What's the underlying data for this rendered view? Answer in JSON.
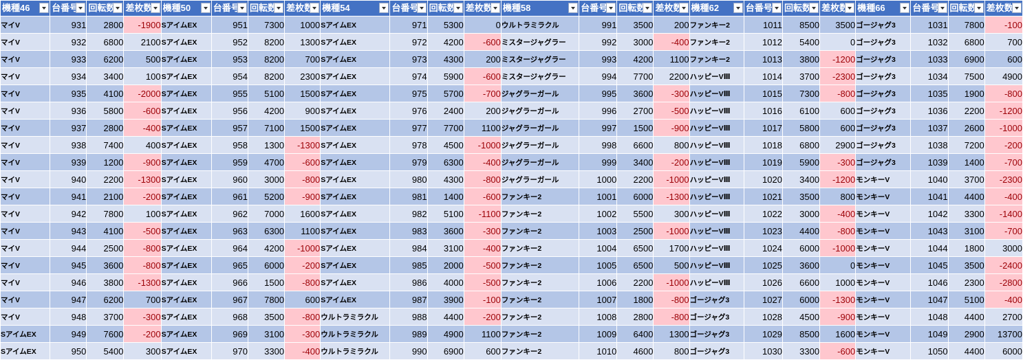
{
  "sheet": {
    "headers": [
      "機種46",
      "台番号",
      "回転数",
      "差枚数",
      "機種50",
      "台番号",
      "回転数",
      "差枚数",
      "機種54",
      "台番号",
      "回転数",
      "差枚数",
      "機種58",
      "台番号",
      "回転数",
      "差枚数",
      "機種62",
      "台番号",
      "回転数",
      "差枚数",
      "機種66",
      "台番号",
      "回転数",
      "差枚数"
    ],
    "rows": [
      [
        "マイV",
        "931",
        "2800",
        "-1900",
        "SアイムEX",
        "951",
        "7300",
        "1000",
        "SアイムEX",
        "971",
        "5300",
        "0",
        "ウルトラミラクル",
        "991",
        "3500",
        "200",
        "ファンキー2",
        "1011",
        "8500",
        "3500",
        "ゴージャグ3",
        "1031",
        "7800",
        "-100"
      ],
      [
        "マイV",
        "932",
        "6800",
        "2100",
        "SアイムEX",
        "952",
        "8200",
        "1300",
        "SアイムEX",
        "972",
        "4200",
        "-600",
        "ミスタージャグラー",
        "992",
        "3000",
        "-400",
        "ファンキー2",
        "1012",
        "5400",
        "0",
        "ゴージャグ3",
        "1032",
        "6800",
        "700"
      ],
      [
        "マイV",
        "933",
        "6200",
        "500",
        "SアイムEX",
        "953",
        "8200",
        "700",
        "SアイムEX",
        "973",
        "4300",
        "200",
        "ミスタージャグラー",
        "993",
        "4200",
        "1100",
        "ファンキー2",
        "1013",
        "3800",
        "-1200",
        "ゴージャグ3",
        "1033",
        "6900",
        "600"
      ],
      [
        "マイV",
        "934",
        "3400",
        "100",
        "SアイムEX",
        "954",
        "8200",
        "2300",
        "SアイムEX",
        "974",
        "5900",
        "-600",
        "ミスタージャグラー",
        "994",
        "7700",
        "2200",
        "ハッピーVⅢ",
        "1014",
        "3700",
        "-2300",
        "ゴージャグ3",
        "1034",
        "7500",
        "4900"
      ],
      [
        "マイV",
        "935",
        "4100",
        "-2000",
        "SアイムEX",
        "955",
        "5100",
        "1500",
        "SアイムEX",
        "975",
        "5700",
        "-700",
        "ジャグラーガール",
        "995",
        "3600",
        "-300",
        "ハッピーVⅢ",
        "1015",
        "7300",
        "-800",
        "ゴージャグ3",
        "1035",
        "1900",
        "-800"
      ],
      [
        "マイV",
        "936",
        "5800",
        "-600",
        "SアイムEX",
        "956",
        "4200",
        "900",
        "SアイムEX",
        "976",
        "2400",
        "200",
        "ジャグラーガール",
        "996",
        "2700",
        "-500",
        "ハッピーVⅢ",
        "1016",
        "6100",
        "600",
        "ゴージャグ3",
        "1036",
        "2200",
        "-1200"
      ],
      [
        "マイV",
        "937",
        "2800",
        "-400",
        "SアイムEX",
        "957",
        "7100",
        "1500",
        "SアイムEX",
        "977",
        "7700",
        "1100",
        "ジャグラーガール",
        "997",
        "1500",
        "-900",
        "ハッピーVⅢ",
        "1017",
        "5800",
        "600",
        "ゴージャグ3",
        "1037",
        "2600",
        "-1000"
      ],
      [
        "マイV",
        "938",
        "7400",
        "400",
        "SアイムEX",
        "958",
        "1300",
        "-1300",
        "SアイムEX",
        "978",
        "4500",
        "-1000",
        "ジャグラーガール",
        "998",
        "6600",
        "800",
        "ハッピーVⅢ",
        "1018",
        "6800",
        "2900",
        "ゴージャグ3",
        "1038",
        "7200",
        "-200"
      ],
      [
        "マイV",
        "939",
        "1200",
        "-900",
        "SアイムEX",
        "959",
        "4700",
        "-600",
        "SアイムEX",
        "979",
        "6300",
        "-400",
        "ジャグラーガール",
        "999",
        "3400",
        "-200",
        "ハッピーVⅢ",
        "1019",
        "5900",
        "-300",
        "ゴージャグ3",
        "1039",
        "1400",
        "-700"
      ],
      [
        "マイV",
        "940",
        "2200",
        "-1300",
        "SアイムEX",
        "960",
        "3000",
        "-800",
        "SアイムEX",
        "980",
        "4300",
        "-800",
        "ジャグラーガール",
        "1000",
        "2200",
        "-1000",
        "ハッピーVⅢ",
        "1020",
        "3400",
        "-1200",
        "モンキーV",
        "1040",
        "3700",
        "-2300"
      ],
      [
        "マイV",
        "941",
        "2100",
        "-200",
        "SアイムEX",
        "961",
        "5200",
        "-900",
        "SアイムEX",
        "981",
        "1400",
        "-600",
        "ファンキー2",
        "1001",
        "6000",
        "-1300",
        "ハッピーVⅢ",
        "1021",
        "3500",
        "800",
        "モンキーV",
        "1041",
        "4400",
        "-400"
      ],
      [
        "マイV",
        "942",
        "7800",
        "100",
        "SアイムEX",
        "962",
        "7000",
        "1600",
        "SアイムEX",
        "982",
        "5100",
        "-1100",
        "ファンキー2",
        "1002",
        "5500",
        "300",
        "ハッピーVⅢ",
        "1022",
        "3000",
        "-400",
        "モンキーV",
        "1042",
        "3300",
        "-1400"
      ],
      [
        "マイV",
        "943",
        "4100",
        "-500",
        "SアイムEX",
        "963",
        "6300",
        "1100",
        "SアイムEX",
        "983",
        "3600",
        "-300",
        "ファンキー2",
        "1003",
        "2500",
        "-1000",
        "ハッピーVⅢ",
        "1023",
        "4400",
        "-800",
        "モンキーV",
        "1043",
        "3100",
        "-700"
      ],
      [
        "マイV",
        "944",
        "2500",
        "-800",
        "SアイムEX",
        "964",
        "4200",
        "-1000",
        "SアイムEX",
        "984",
        "3100",
        "-400",
        "ファンキー2",
        "1004",
        "6500",
        "1700",
        "ハッピーVⅢ",
        "1024",
        "6000",
        "-1000",
        "モンキーV",
        "1044",
        "1800",
        "3000"
      ],
      [
        "マイV",
        "945",
        "3600",
        "-800",
        "SアイムEX",
        "965",
        "6000",
        "-200",
        "SアイムEX",
        "985",
        "2000",
        "-500",
        "ファンキー2",
        "1005",
        "6500",
        "500",
        "ハッピーVⅢ",
        "1025",
        "3600",
        "0",
        "モンキーV",
        "1045",
        "3500",
        "-2400"
      ],
      [
        "マイV",
        "946",
        "3800",
        "-1300",
        "SアイムEX",
        "966",
        "1500",
        "-800",
        "SアイムEX",
        "986",
        "4000",
        "-500",
        "ファンキー2",
        "1006",
        "2200",
        "-1000",
        "ハッピーVⅢ",
        "1026",
        "6600",
        "1000",
        "モンキーV",
        "1046",
        "2300",
        "-2800"
      ],
      [
        "マイV",
        "947",
        "6200",
        "700",
        "SアイムEX",
        "967",
        "7800",
        "600",
        "SアイムEX",
        "987",
        "3900",
        "-100",
        "ファンキー2",
        "1007",
        "1800",
        "-800",
        "ゴージャグ3",
        "1027",
        "6000",
        "-1300",
        "モンキーV",
        "1047",
        "5100",
        "-400"
      ],
      [
        "マイV",
        "948",
        "3700",
        "-300",
        "SアイムEX",
        "968",
        "3500",
        "-800",
        "ウルトラミラクル",
        "988",
        "4400",
        "-200",
        "ファンキー2",
        "1008",
        "2800",
        "-800",
        "ゴージャグ3",
        "1028",
        "4500",
        "-900",
        "モンキーV",
        "1048",
        "4400",
        "2700"
      ],
      [
        "SアイムEX",
        "949",
        "7600",
        "-200",
        "SアイムEX",
        "969",
        "3100",
        "-300",
        "ウルトラミラクル",
        "989",
        "4900",
        "1100",
        "ファンキー2",
        "1009",
        "6400",
        "1300",
        "ゴージャグ3",
        "1029",
        "8500",
        "1600",
        "モンキーV",
        "1049",
        "2900",
        "13700"
      ],
      [
        "SアイムEX",
        "950",
        "5400",
        "300",
        "SアイムEX",
        "970",
        "3300",
        "-400",
        "ウルトラミラクル",
        "990",
        "6900",
        "600",
        "ファンキー2",
        "1010",
        "4600",
        "800",
        "ゴージャグ3",
        "1030",
        "3300",
        "-600",
        "モンキーV",
        "1050",
        "4400",
        "6000"
      ]
    ],
    "colors": {
      "header_bg": "#4472C4",
      "row_band_1": "#B4C6E7",
      "row_band_2": "#D9E1F2",
      "negative_bg": "#FFC7CE",
      "negative_text": "#9C0006"
    },
    "icons": {
      "header_filter": "filter-dropdown-icon"
    }
  }
}
